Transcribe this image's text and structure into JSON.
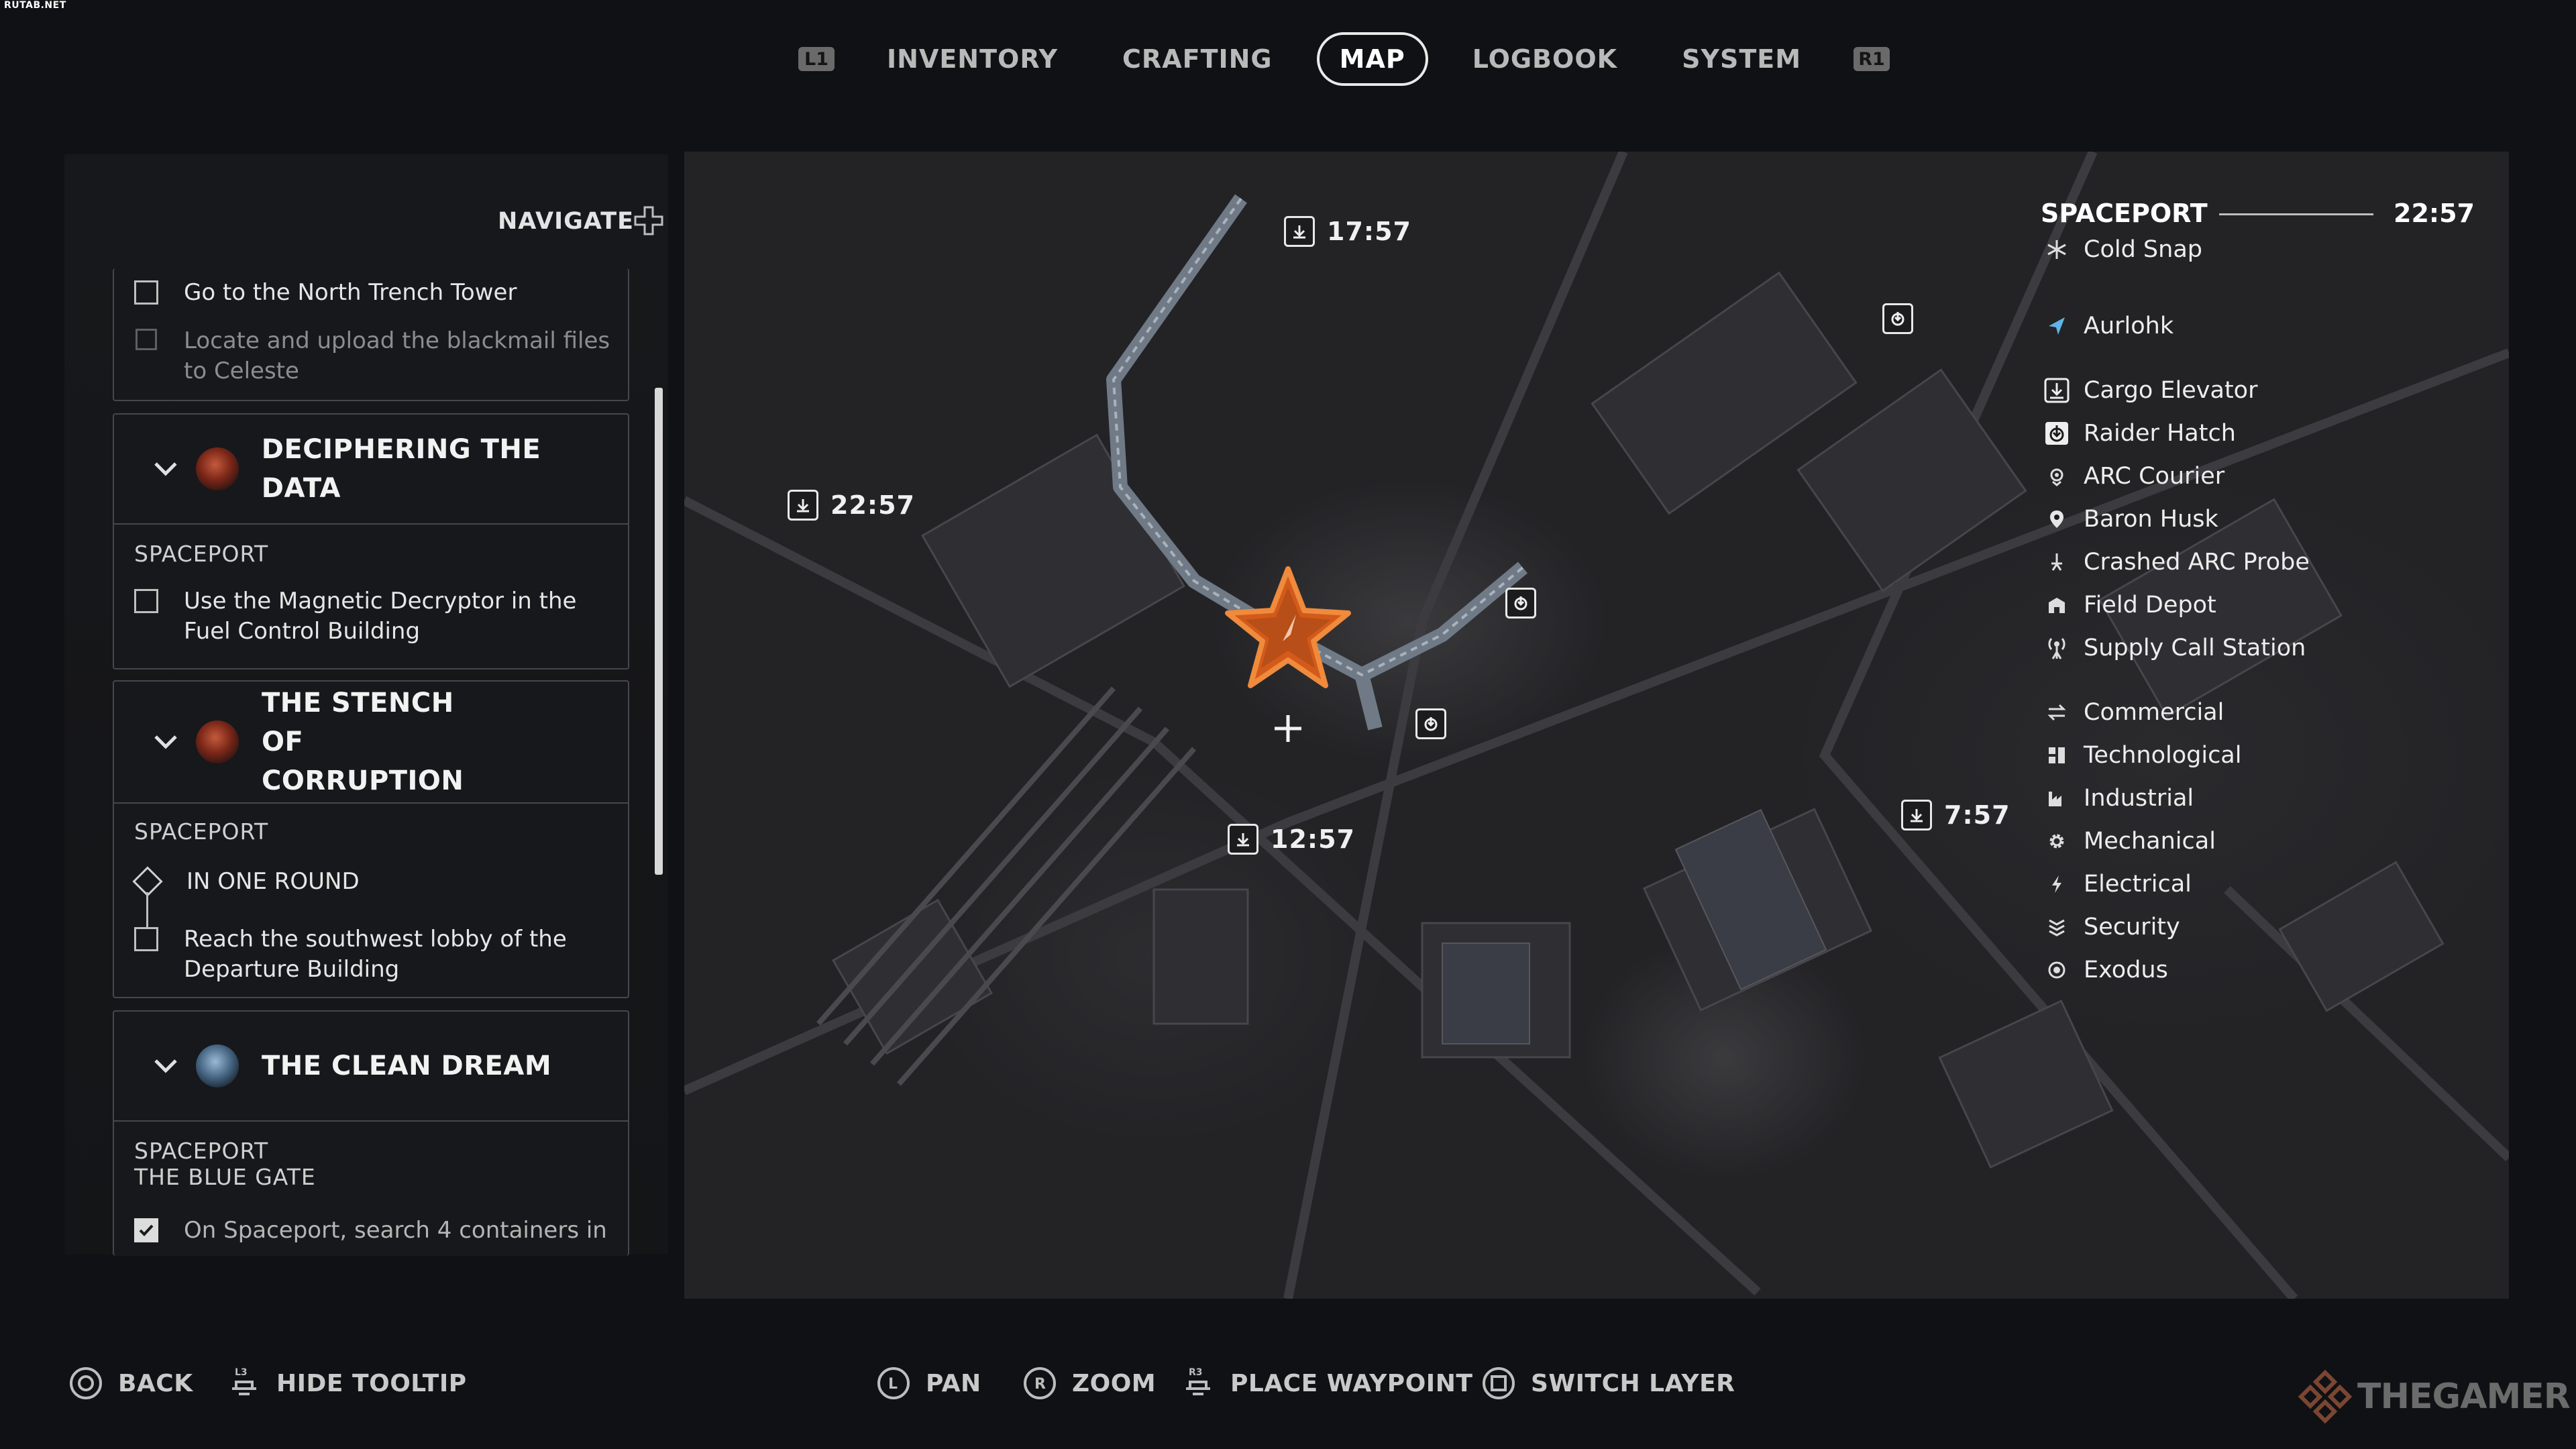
{
  "watermark": "RUTAB.NET",
  "topnav": {
    "left_bumper": "L1",
    "right_bumper": "R1",
    "tabs": [
      "INVENTORY",
      "CRAFTING",
      "MAP",
      "LOGBOOK",
      "SYSTEM"
    ],
    "active_tab": "MAP"
  },
  "quest_panel": {
    "navigate_label": "NAVIGATE",
    "top_objectives": [
      {
        "text": "Go to the North Trench Tower",
        "state": "unchecked"
      },
      {
        "text": "Locate and upload the blackmail files to Celeste",
        "state": "dim"
      }
    ],
    "quests": [
      {
        "title": "DECIPHERING THE DATA",
        "region": "SPACEPORT",
        "objectives": [
          {
            "text": "Use the Magnetic Decryptor in the Fuel Control Building",
            "state": "unchecked"
          }
        ]
      },
      {
        "title": "THE STENCH OF CORRUPTION",
        "region": "SPACEPORT",
        "objectives": [
          {
            "text": "IN ONE ROUND",
            "state": "diamond"
          },
          {
            "text": "Reach the southwest lobby of the Departure Building",
            "state": "unchecked"
          }
        ]
      },
      {
        "title": "THE CLEAN DREAM",
        "region": "SPACEPORT",
        "subregion": "THE BLUE GATE",
        "objectives": [
          {
            "text": "On Spaceport, search 4 containers in",
            "state": "checked"
          }
        ]
      }
    ]
  },
  "map": {
    "timers": [
      "17:57",
      "22:57",
      "12:57",
      "7:57"
    ],
    "player_marker_color": "#e8641e"
  },
  "legend": {
    "title": "SPACEPORT",
    "time": "22:57",
    "condition": {
      "icon": "snowflake-icon",
      "label": "Cold Snap"
    },
    "player": {
      "icon": "arrow-icon",
      "label": "Aurlohk",
      "color": "#5fb4e8"
    },
    "points": [
      {
        "icon": "cargo-elevator-icon",
        "label": "Cargo Elevator"
      },
      {
        "icon": "raider-hatch-icon",
        "label": "Raider Hatch"
      },
      {
        "icon": "arc-courier-icon",
        "label": "ARC Courier"
      },
      {
        "icon": "pin-icon",
        "label": "Baron Husk"
      },
      {
        "icon": "probe-icon",
        "label": "Crashed ARC Probe"
      },
      {
        "icon": "depot-icon",
        "label": "Field Depot"
      },
      {
        "icon": "antenna-icon",
        "label": "Supply Call Station"
      }
    ],
    "zones": [
      {
        "icon": "arrows-icon",
        "label": "Commercial"
      },
      {
        "icon": "chip-icon",
        "label": "Technological"
      },
      {
        "icon": "factory-icon",
        "label": "Industrial"
      },
      {
        "icon": "gear-icon",
        "label": "Mechanical"
      },
      {
        "icon": "bolt-icon",
        "label": "Electrical"
      },
      {
        "icon": "chevrons-icon",
        "label": "Security"
      },
      {
        "icon": "target-icon",
        "label": "Exodus"
      }
    ]
  },
  "bottom_bar": {
    "back": "BACK",
    "hide_tooltip": "HIDE TOOLTIP",
    "hide_tooltip_key": "L3",
    "pan": "PAN",
    "pan_key": "L",
    "zoom": "ZOOM",
    "zoom_key": "R",
    "place_waypoint": "PLACE WAYPOINT",
    "place_waypoint_key": "R3",
    "switch_layer": "SWITCH LAYER"
  },
  "brand": "THEGAMER"
}
